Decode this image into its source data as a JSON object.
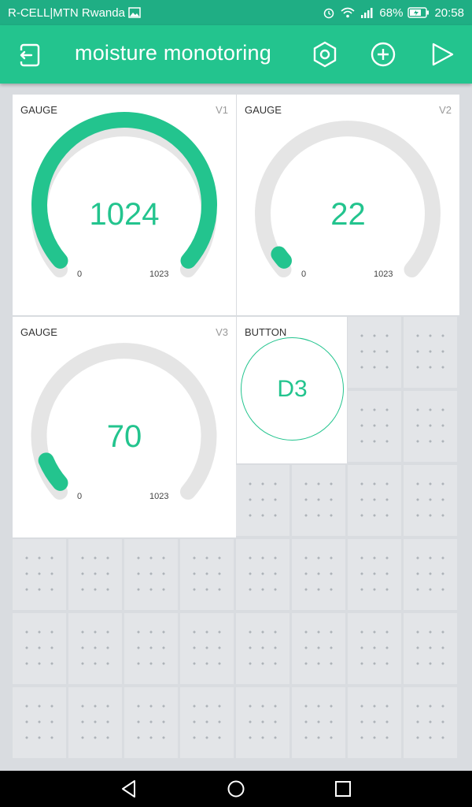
{
  "status": {
    "carrier": "R-CELL|MTN Rwanda",
    "battery": "68%",
    "time": "20:58"
  },
  "appbar": {
    "title": "moisture monotoring",
    "icons": [
      "exit-icon",
      "settings-hexagon-icon",
      "add-widget-icon",
      "play-icon"
    ]
  },
  "widgets": {
    "gauge1": {
      "label": "GAUGE",
      "pin": "V1",
      "value": "1024",
      "min": "0",
      "max": "1023",
      "level": 1.0
    },
    "gauge2": {
      "label": "GAUGE",
      "pin": "V2",
      "value": "22",
      "min": "0",
      "max": "1023",
      "level": 0.0215
    },
    "gauge3": {
      "label": "GAUGE",
      "pin": "V3",
      "value": "70",
      "min": "0",
      "max": "1023",
      "level": 0.0684
    },
    "button": {
      "label": "BUTTON",
      "text": "D3"
    }
  },
  "colors": {
    "accent": "#23c48e",
    "statusbar": "#1fae84",
    "track": "#e5e5e5"
  }
}
